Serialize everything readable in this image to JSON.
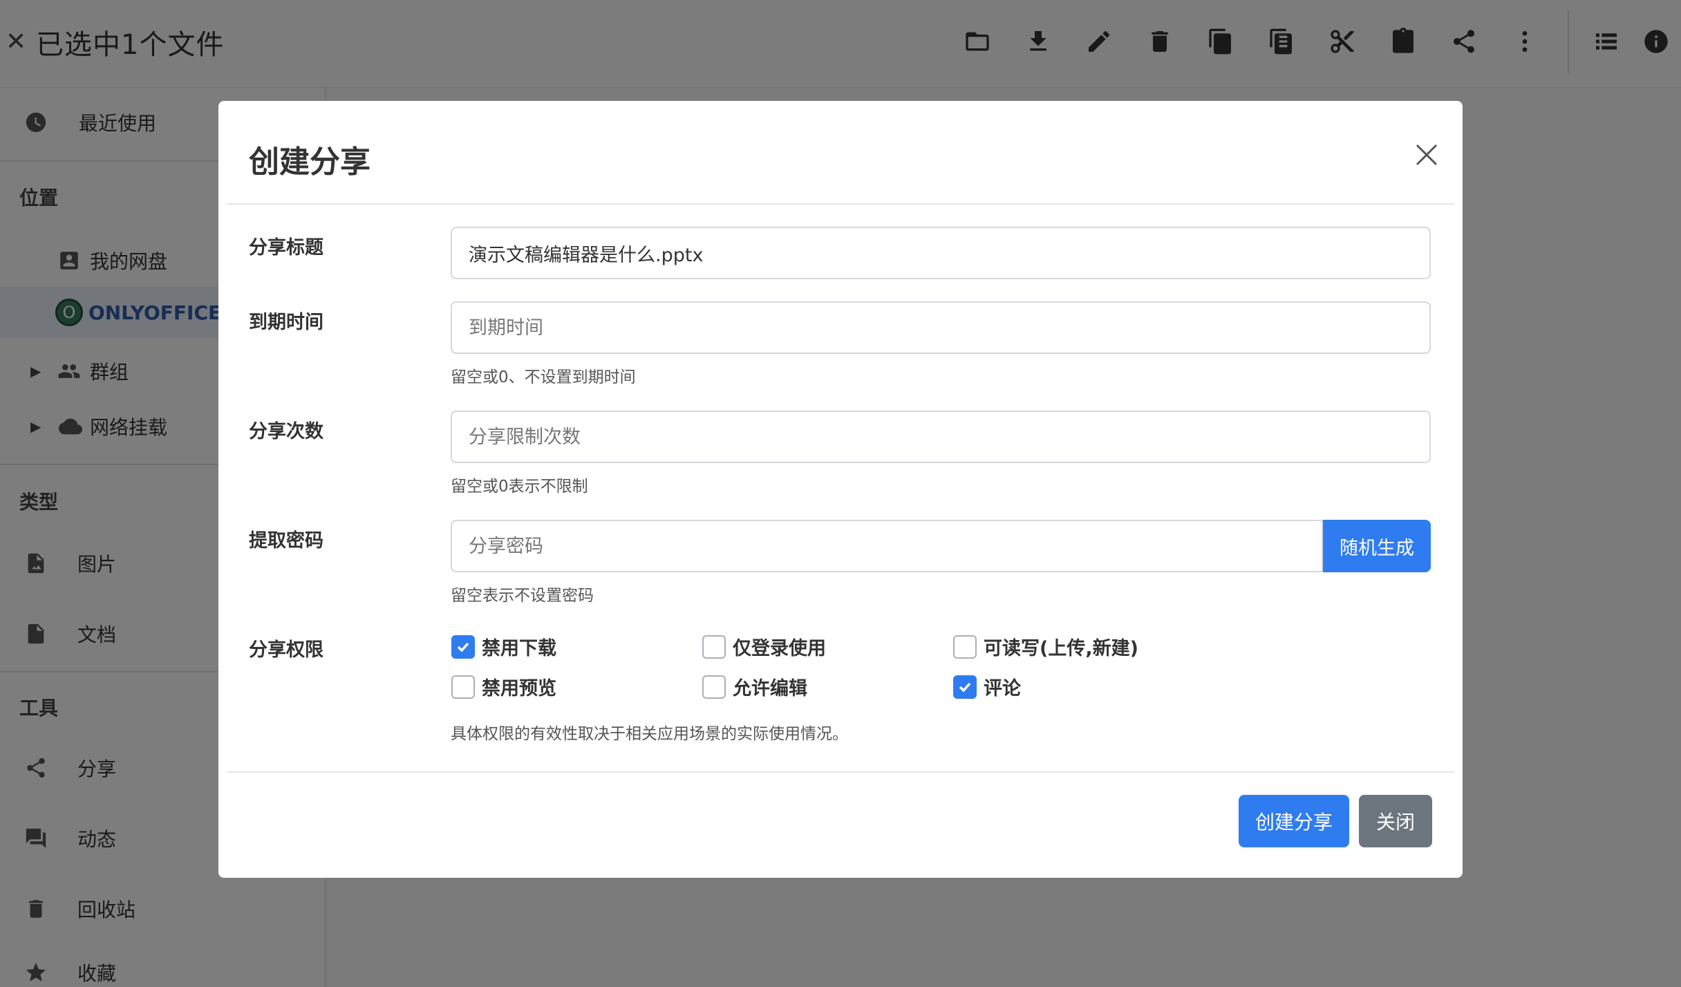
{
  "topbar": {
    "close_glyph": "✕",
    "selection_title": "已选中1个文件",
    "icons": [
      "folder-open-icon",
      "download-icon",
      "edit-icon",
      "delete-icon",
      "copy-icon",
      "copy-to-icon",
      "cut-icon",
      "paste-icon",
      "share-icon",
      "more-icon",
      "list-view-icon",
      "info-icon"
    ]
  },
  "sidebar": {
    "recent": "最近使用",
    "section_location": "位置",
    "my_drive": "我的网盘",
    "onlyoffice": "ONLYOFFICE",
    "onlyoffice_avatar": "O",
    "groups": "群组",
    "network_mount": "网络挂载",
    "section_type": "类型",
    "images": "图片",
    "documents": "文档",
    "section_tools": "工具",
    "share": "分享",
    "activity": "动态",
    "recycle_bin": "回收站",
    "favorites": "收藏"
  },
  "dialog": {
    "title": "创建分享",
    "title_label": "分享标题",
    "title_value": "演示文稿编辑器是什么.pptx",
    "expire_label": "到期时间",
    "expire_placeholder": "到期时间",
    "expire_help": "留空或0、不设置到期时间",
    "count_label": "分享次数",
    "count_placeholder": "分享限制次数",
    "count_help": "留空或0表示不限制",
    "password_label": "提取密码",
    "password_placeholder": "分享密码",
    "random_button": "随机生成",
    "password_help": "留空表示不设置密码",
    "permissions_label": "分享权限",
    "permissions": [
      {
        "label": "禁用下载",
        "checked": true
      },
      {
        "label": "仅登录使用",
        "checked": false
      },
      {
        "label": "可读写(上传,新建)",
        "checked": false
      },
      {
        "label": "禁用预览",
        "checked": false
      },
      {
        "label": "允许编辑",
        "checked": false
      },
      {
        "label": "评论",
        "checked": true
      }
    ],
    "permissions_help": "具体权限的有效性取决于相关应用场景的实际使用情况。",
    "create_button": "创建分享",
    "close_button": "关闭"
  },
  "colors": {
    "primary": "#2f7cf0",
    "secondary": "#6c757d",
    "onlyoffice": "#2f5aa8"
  }
}
